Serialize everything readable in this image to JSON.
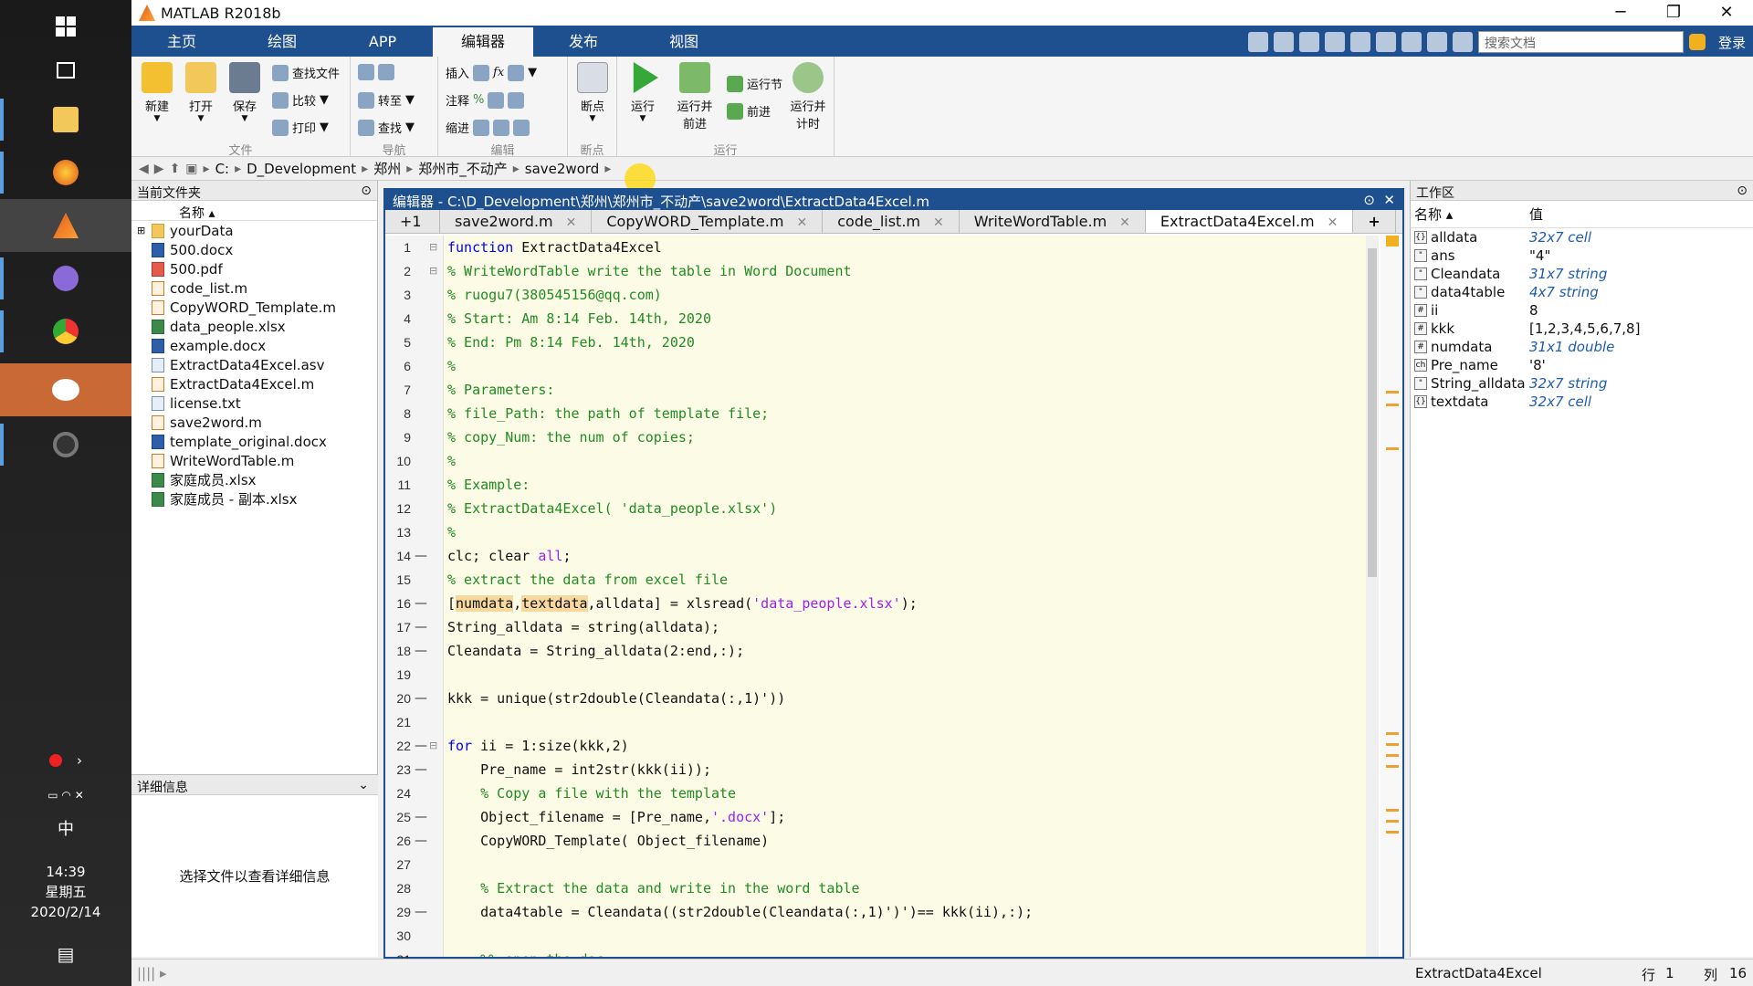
{
  "taskbar": {
    "clock": {
      "time": "14:39",
      "day": "星期五",
      "date": "2020/2/14"
    },
    "ime": "中"
  },
  "title": "MATLAB R2018b",
  "ribbon_tabs": [
    "主页",
    "绘图",
    "APP",
    "编辑器",
    "发布",
    "视图"
  ],
  "search_placeholder": "搜索文档",
  "login": "登录",
  "ribbon": {
    "file": {
      "title": "文件",
      "new": "新建",
      "open": "打开",
      "save": "保存",
      "find_files": "查找文件",
      "compare": "比较",
      "print": "打印"
    },
    "nav": {
      "title": "导航",
      "goto": "转至",
      "find": "查找"
    },
    "edit": {
      "title": "编辑",
      "insert": "插入",
      "comment": "注释",
      "indent": "缩进",
      "fx": "fx"
    },
    "breakpoints": {
      "title": "断点",
      "label": "断点"
    },
    "run": {
      "title": "运行",
      "run": "运行",
      "run_advance": "运行并\n前进",
      "run_section": "运行节",
      "advance": "前进",
      "run_time": "运行并\n计时"
    }
  },
  "address": [
    "C:",
    "D_Development",
    "郑州",
    "郑州市_不动产",
    "save2word"
  ],
  "current_folder": {
    "title": "当前文件夹",
    "col": "名称 ▴",
    "items": [
      {
        "name": "yourData",
        "type": "fold"
      },
      {
        "name": "500.docx",
        "type": "doc"
      },
      {
        "name": "500.pdf",
        "type": "pdf"
      },
      {
        "name": "code_list.m",
        "type": "m"
      },
      {
        "name": "CopyWORD_Template.m",
        "type": "m"
      },
      {
        "name": "data_people.xlsx",
        "type": "xls"
      },
      {
        "name": "example.docx",
        "type": "doc"
      },
      {
        "name": "ExtractData4Excel.asv",
        "type": "txt"
      },
      {
        "name": "ExtractData4Excel.m",
        "type": "m"
      },
      {
        "name": "license.txt",
        "type": "txt"
      },
      {
        "name": "save2word.m",
        "type": "m"
      },
      {
        "name": "template_original.docx",
        "type": "doc"
      },
      {
        "name": "WriteWordTable.m",
        "type": "m"
      },
      {
        "name": "家庭成员.xlsx",
        "type": "xls"
      },
      {
        "name": "家庭成员 - 副本.xlsx",
        "type": "xls"
      }
    ]
  },
  "details": {
    "title": "详细信息",
    "msg": "选择文件以查看详细信息"
  },
  "editor": {
    "title": "编辑器 - C:\\D_Development\\郑州\\郑州市_不动产\\save2word\\ExtractData4Excel.m",
    "tabs": [
      "save2word.m",
      "CopyWORD_Template.m",
      "code_list.m",
      "WriteWordTable.m",
      "ExtractData4Excel.m"
    ],
    "active_tab": "ExtractData4Excel.m",
    "plus1": "+1"
  },
  "code": [
    {
      "n": "1",
      "t": "function ExtractData4Excel",
      "c": "fn"
    },
    {
      "n": "2",
      "t": "% WriteWordTable write the table in Word Document",
      "c": "cm"
    },
    {
      "n": "3",
      "t": "% ruogu7(380545156@qq.com)",
      "c": "cm"
    },
    {
      "n": "4",
      "t": "% Start: Am 8:14 Feb. 14th, 2020",
      "c": "cm"
    },
    {
      "n": "5",
      "t": "% End: Pm 8:14 Feb. 14th, 2020",
      "c": "cm"
    },
    {
      "n": "6",
      "t": "%",
      "c": "cm"
    },
    {
      "n": "7",
      "t": "% Parameters:",
      "c": "cm"
    },
    {
      "n": "8",
      "t": "% file_Path: the path of template file;",
      "c": "cm"
    },
    {
      "n": "9",
      "t": "% copy_Num: the num of copies;",
      "c": "cm"
    },
    {
      "n": "10",
      "t": "%",
      "c": "cm"
    },
    {
      "n": "11",
      "t": "% Example:",
      "c": "cm"
    },
    {
      "n": "12",
      "t": "% ExtractData4Excel( 'data_people.xlsx')",
      "c": "cm"
    },
    {
      "n": "13",
      "t": "%",
      "c": "cm"
    },
    {
      "n": "14",
      "t": "clc; clear all;",
      "c": "clr",
      "d": "—"
    },
    {
      "n": "15",
      "t": "% extract the data from excel file",
      "c": "cm"
    },
    {
      "n": "16",
      "t": "[numdata,textdata,alldata] = xlsread('data_people.xlsx');",
      "c": "xls",
      "d": "—"
    },
    {
      "n": "17",
      "t": "String_alldata = string(alldata);",
      "c": "",
      "d": "—"
    },
    {
      "n": "18",
      "t": "Cleandata = String_alldata(2:end,:);",
      "c": "",
      "d": "—"
    },
    {
      "n": "19",
      "t": "",
      "c": ""
    },
    {
      "n": "20",
      "t": "kkk = unique(str2double(Cleandata(:,1)'))",
      "c": "",
      "d": "—"
    },
    {
      "n": "21",
      "t": "",
      "c": ""
    },
    {
      "n": "22",
      "t": "for ii = 1:size(kkk,2)",
      "c": "for",
      "d": "—"
    },
    {
      "n": "23",
      "t": "    Pre_name = int2str(kkk(ii));",
      "c": "",
      "d": "—"
    },
    {
      "n": "24",
      "t": "    % Copy a file with the template",
      "c": "cm"
    },
    {
      "n": "25",
      "t": "    Object_filename = [Pre_name,'.docx'];",
      "c": "docx",
      "d": "—"
    },
    {
      "n": "26",
      "t": "    CopyWORD_Template( Object_filename)",
      "c": "",
      "d": "—"
    },
    {
      "n": "27",
      "t": "",
      "c": ""
    },
    {
      "n": "28",
      "t": "    % Extract the data and write in the word table",
      "c": "cm"
    },
    {
      "n": "29",
      "t": "    data4table = Cleandata((str2double(Cleandata(:,1)')')== kkk(ii),:);",
      "c": "",
      "d": "—"
    },
    {
      "n": "30",
      "t": "",
      "c": ""
    },
    {
      "n": "31",
      "t": "    %% open the doc",
      "c": "cm"
    }
  ],
  "workspace": {
    "title": "工作区",
    "col_name": "名称 ▴",
    "col_val": "值",
    "vars": [
      {
        "name": "alldata",
        "val": "32x7 cell",
        "italic": true,
        "ico": "{}"
      },
      {
        "name": "ans",
        "val": "\"4\"",
        "italic": false,
        "ico": "\""
      },
      {
        "name": "Cleandata",
        "val": "31x7 string",
        "italic": true,
        "ico": "\""
      },
      {
        "name": "data4table",
        "val": "4x7 string",
        "italic": true,
        "ico": "\""
      },
      {
        "name": "ii",
        "val": "8",
        "italic": false,
        "ico": "#"
      },
      {
        "name": "kkk",
        "val": "[1,2,3,4,5,6,7,8]",
        "italic": false,
        "ico": "#"
      },
      {
        "name": "numdata",
        "val": "31x1 double",
        "italic": true,
        "ico": "#"
      },
      {
        "name": "Pre_name",
        "val": "'8'",
        "italic": false,
        "ico": "ch"
      },
      {
        "name": "String_alldata",
        "val": "32x7 string",
        "italic": true,
        "ico": "\""
      },
      {
        "name": "textdata",
        "val": "32x7 cell",
        "italic": true,
        "ico": "{}"
      }
    ]
  },
  "status": {
    "func": "ExtractData4Excel",
    "row_label": "行",
    "row": "1",
    "col_label": "列",
    "col": "16"
  }
}
